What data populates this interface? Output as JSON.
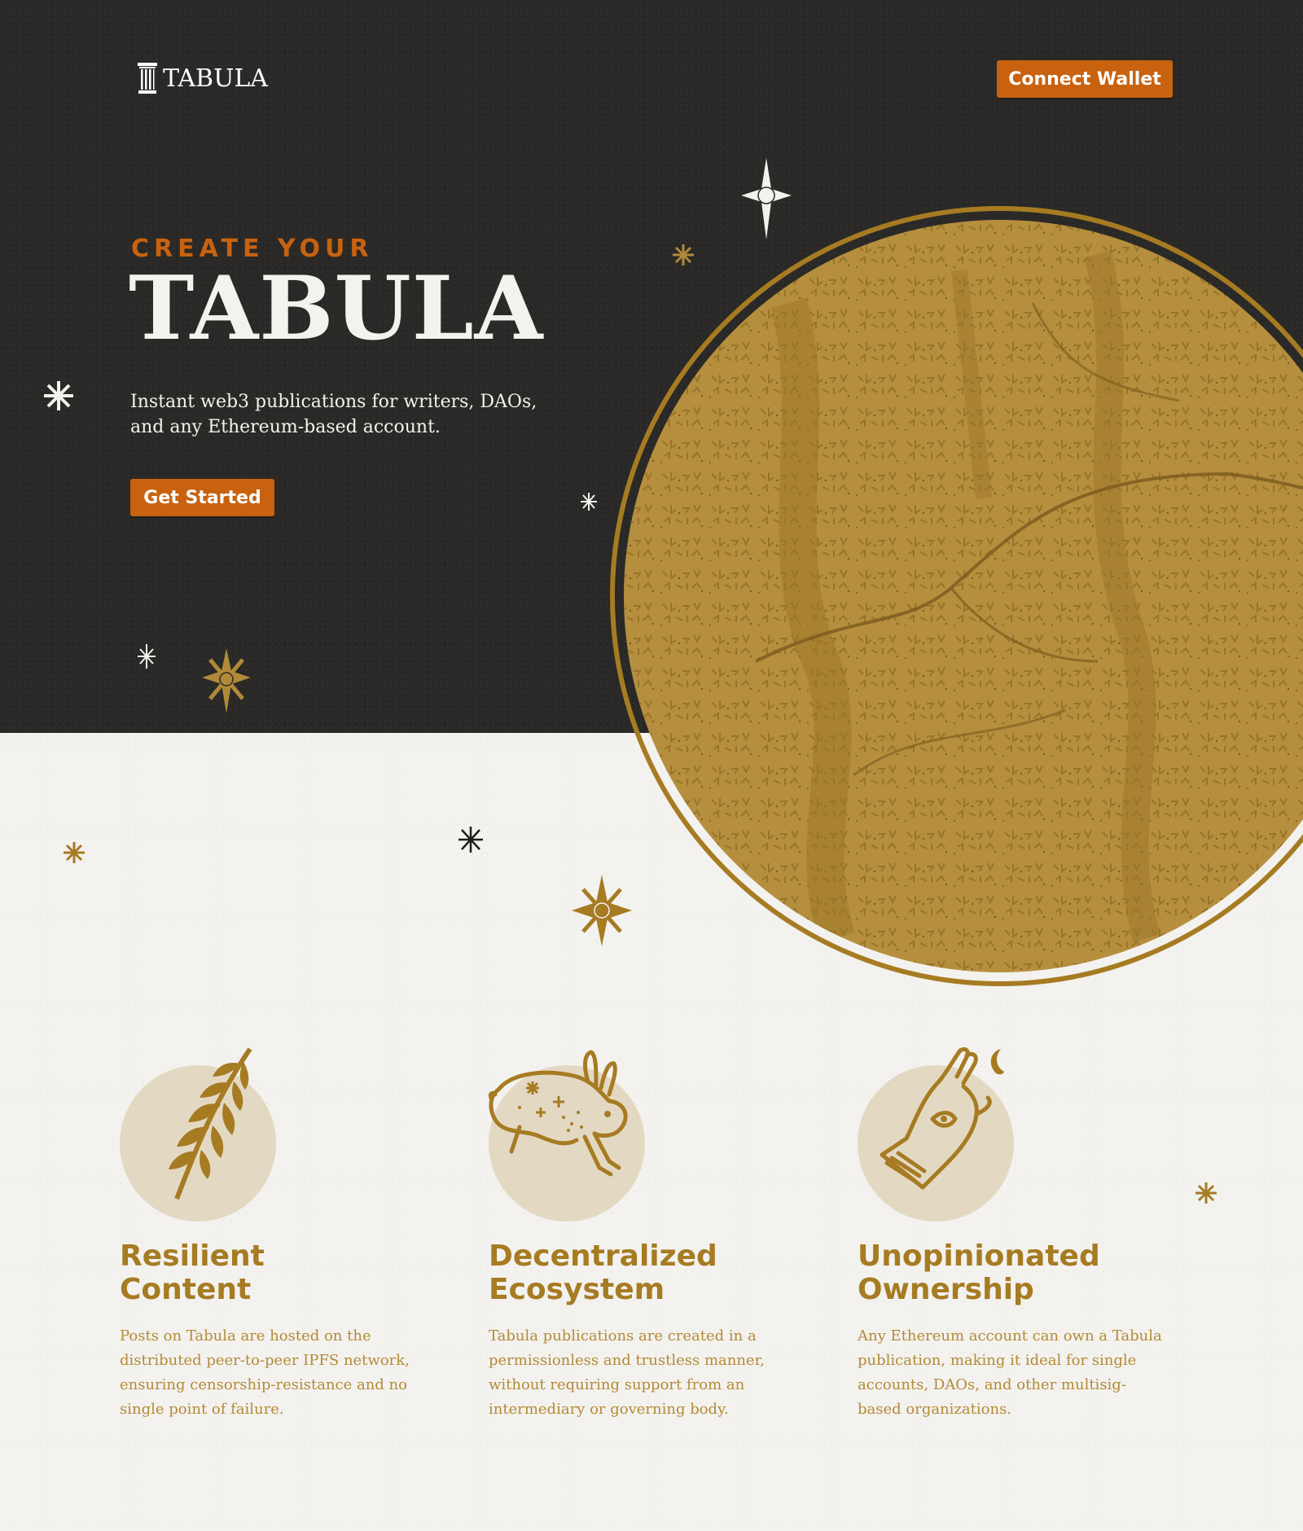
{
  "header": {
    "logo_text": "TABULA",
    "connect_label": "Connect Wallet"
  },
  "hero": {
    "eyebrow": "CREATE YOUR",
    "title": "TABULA",
    "subtitle_line1": "Instant web3 publications for writers, DAOs,",
    "subtitle_line2": "and any Ethereum-based account.",
    "cta_label": "Get Started"
  },
  "features": [
    {
      "icon": "fern-icon",
      "title_line1": "Resilient",
      "title_line2": "Content",
      "description": "Posts on Tabula are hosted on the distributed peer-to-peer IPFS network, ensuring censorship-resistance and no single point of failure."
    },
    {
      "icon": "rabbit-icon",
      "title_line1": "Decentralized",
      "title_line2": "Ecosystem",
      "description": "Tabula publications are created in a permissionless and trustless manner, without requiring support from an intermediary or governing body."
    },
    {
      "icon": "hand-icon",
      "title_line1": "Unopinionated",
      "title_line2": "Ownership",
      "description": "Any Ethereum account can own a Tabula publication, making it ideal for single accounts, DAOs, and other multisig-based organizations."
    }
  ],
  "colors": {
    "hero_bg": "#2a2927",
    "accent_orange": "#c8620f",
    "gold": "#a67b22",
    "circle_fill": "#b08a38",
    "light_bg": "#f3f2ef"
  }
}
